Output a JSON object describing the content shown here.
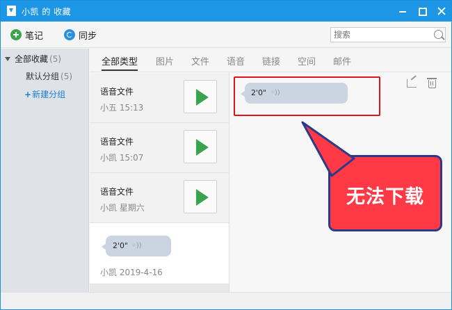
{
  "window": {
    "title": "小凯 的 收藏"
  },
  "toolbar": {
    "note_label": "笔记",
    "sync_label": "同步",
    "search_placeholder": "搜索"
  },
  "sidebar": {
    "all_label": "全部收藏",
    "all_count": "(5)",
    "default_group_label": "默认分组",
    "default_group_count": "(5)",
    "new_group_label": "新建分组"
  },
  "tabs": [
    "全部类型",
    "图片",
    "文件",
    "语音",
    "链接",
    "空间",
    "邮件"
  ],
  "list_items": [
    {
      "title": "语音文件",
      "meta": "小五 15:13"
    },
    {
      "title": "语音文件",
      "meta": "小凯 15:07"
    },
    {
      "title": "语音文件",
      "meta": "小凯 星期六"
    }
  ],
  "selected_item": {
    "duration": "2'0\"",
    "meta": "小凯 2019-4-16"
  },
  "detail": {
    "duration": "2'0\""
  },
  "callout": {
    "text": "无法下载"
  },
  "colors": {
    "titlebar": "#1d96e5",
    "accent_blue": "#1d7fd6",
    "play_green": "#3ba34d",
    "highlight_red": "#e1121a",
    "callout_red": "#ff3a46",
    "callout_border": "#2b3a8a"
  }
}
